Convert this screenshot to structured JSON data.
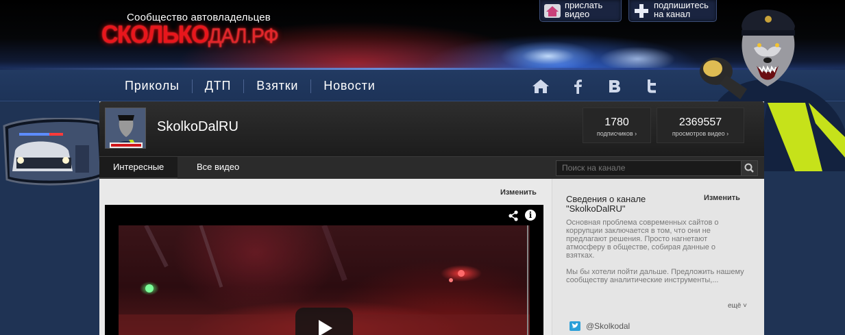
{
  "header": {
    "logo_subtitle": "Сообщество автовладельцев",
    "logo_main_bold": "СКОЛЬКО",
    "logo_main_thin": "ДАЛ.РФ",
    "send_video": [
      "прислать",
      "видео"
    ],
    "subscribe": [
      "подпишитесь",
      "на канал"
    ]
  },
  "nav": {
    "items": [
      "Приколы",
      "ДТП",
      "Взятки",
      "Новости"
    ],
    "social_icons": [
      "home-icon",
      "facebook-icon",
      "vkontakte-icon",
      "twitter-icon"
    ]
  },
  "channel": {
    "name": "SkolkoDalRU",
    "subscribers_count": "1780",
    "subscribers_label": "подписчиков ›",
    "views_count": "2369557",
    "views_label": "просмотров видео ›",
    "tabs": [
      "Интересные",
      "Все видео"
    ],
    "search_placeholder": "Поиск на канале"
  },
  "main": {
    "edit_label": "Изменить"
  },
  "about": {
    "title": "Сведения о канале \"SkolkoDalRU\"",
    "edit_label": "Изменить",
    "paragraph1": "Основная проблема современных сайтов о коррупции заключается в том, что они не предлагают решения. Просто нагнетают атмосферу в обществе, собирая данные о взятках.",
    "paragraph2": "Мы бы хотели пойти дальше. Предложить нашему сообществу аналитические инструменты,...",
    "more": "ещё ˅",
    "twitter": "@Skolkodal"
  },
  "colors": {
    "logo_red": "#e8161c",
    "navbar_blue": "#223a62",
    "panel_dark": "#1c1c1c"
  }
}
